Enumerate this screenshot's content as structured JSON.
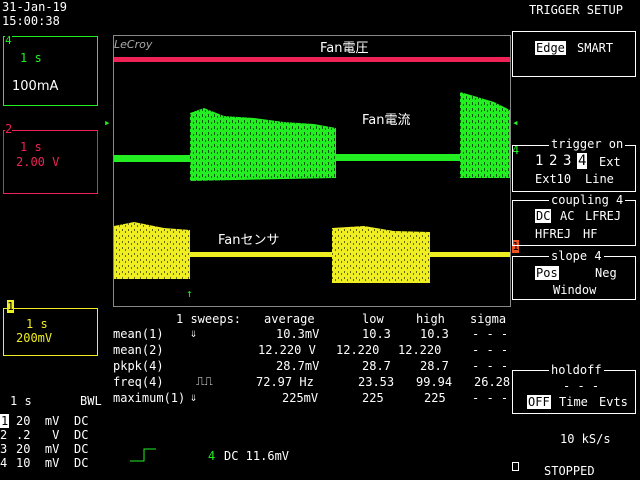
{
  "header": {
    "date": "31-Jan-19",
    "time": "15:00:38",
    "menu_title": "TRIGGER SETUP"
  },
  "screen": {
    "brand": "LeCroy",
    "trace_labels": {
      "fan_voltage": "Fan電圧",
      "fan_current": "Fan電流",
      "fan_sensor": "Fanセンサ"
    }
  },
  "channels": {
    "ch4": {
      "id": "4",
      "timebase": "1 s",
      "scale": "100mA",
      "color": "#22ee22"
    },
    "ch2": {
      "id": "2",
      "timebase": "1 s",
      "scale": "2.00 V",
      "color": "#ee2255"
    },
    "ch1": {
      "id": "1",
      "timebase": "1 s",
      "scale": "200mV",
      "color": "#eeee22"
    }
  },
  "trigger_menu": {
    "type": {
      "selected": "Edge",
      "other": "SMART"
    },
    "trigger_on": {
      "title": "trigger on",
      "sources": [
        "1",
        "2",
        "3",
        "4",
        "Ext"
      ],
      "selected": "4",
      "extra": [
        "Ext10",
        "Line"
      ]
    },
    "coupling": {
      "title": "coupling 4",
      "row1": [
        "DC",
        "AC",
        "LFREJ"
      ],
      "row2": [
        "HFREJ",
        "HF"
      ],
      "selected": "DC"
    },
    "slope": {
      "title": "slope 4",
      "row1": [
        "Pos",
        "Neg"
      ],
      "row2": "Window",
      "selected": "Pos"
    },
    "holdoff": {
      "title": "holdoff",
      "dashes": "- - -",
      "options": [
        "OFF",
        "Time",
        "Evts"
      ],
      "selected": "OFF"
    }
  },
  "measurements": {
    "sweeps": "1 sweeps:",
    "headers": [
      "average",
      "low",
      "high",
      "sigma"
    ],
    "rows": [
      {
        "label": "mean(1)",
        "arrow": "⇓",
        "average": "10.3mV",
        "low": "10.3",
        "high": "10.3",
        "sigma": "- - -"
      },
      {
        "label": "mean(2)",
        "arrow": "",
        "average": "12.220 V",
        "low": "12.220",
        "high": "12.220",
        "sigma": "- - -"
      },
      {
        "label": "pkpk(4)",
        "arrow": "",
        "average": "28.7mV",
        "low": "28.7",
        "high": "28.7",
        "sigma": "- - -"
      },
      {
        "label": "freq(4)",
        "arrow": "⎍⎍",
        "average": "72.97 Hz",
        "low": "23.53",
        "high": "99.94",
        "sigma": "26.28"
      },
      {
        "label": "maximum(1)",
        "arrow": "⇓",
        "average": "225mV",
        "low": "225",
        "high": "225",
        "sigma": "- - -"
      }
    ]
  },
  "bottom": {
    "timebase": "1  s",
    "bwl": "BWL",
    "channel_rows": [
      {
        "ch": "1",
        "value": "20  mV",
        "coupling": "DC"
      },
      {
        "ch": "2",
        "value": ".2   V",
        "coupling": "DC"
      },
      {
        "ch": "3",
        "value": "20  mV",
        "coupling": "DC"
      },
      {
        "ch": "4",
        "value": "10  mV",
        "coupling": "DC"
      }
    ],
    "trigger_readout": "DC 11.6mV",
    "trigger_ch": "4",
    "sample_rate": "10 kS/s",
    "status": "STOPPED"
  }
}
